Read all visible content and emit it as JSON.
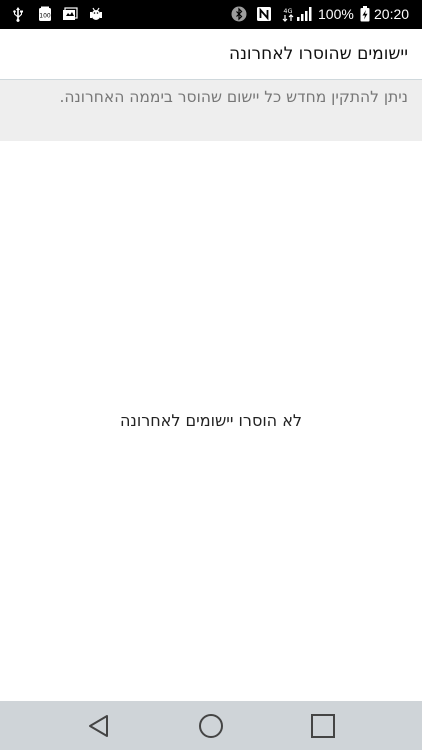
{
  "status_bar": {
    "battery_percent": "100%",
    "time": "20:20",
    "network_badge": "4G",
    "notification_badge": "100",
    "icons": [
      "usb-icon",
      "storage-100-icon",
      "photo-icon",
      "android-debug-icon",
      "bluetooth-icon",
      "nfc-icon",
      "4g-icon",
      "signal-icon",
      "battery-charging-icon"
    ]
  },
  "app_bar": {
    "title": "יישומים שהוסרו לאחרונה"
  },
  "info": {
    "text": "ניתן להתקין מחדש כל יישום שהוסר ביממה האחרונה."
  },
  "main": {
    "empty_message": "לא הוסרו יישומים לאחרונה"
  },
  "nav_bar": {
    "icons": [
      "back-icon",
      "home-icon",
      "recents-icon"
    ]
  },
  "colors": {
    "status_bar_bg": "#000000",
    "info_panel_bg": "#eeeeee",
    "nav_bar_bg": "#cfd4d8",
    "title_text": "#111111",
    "info_text": "#777777"
  }
}
